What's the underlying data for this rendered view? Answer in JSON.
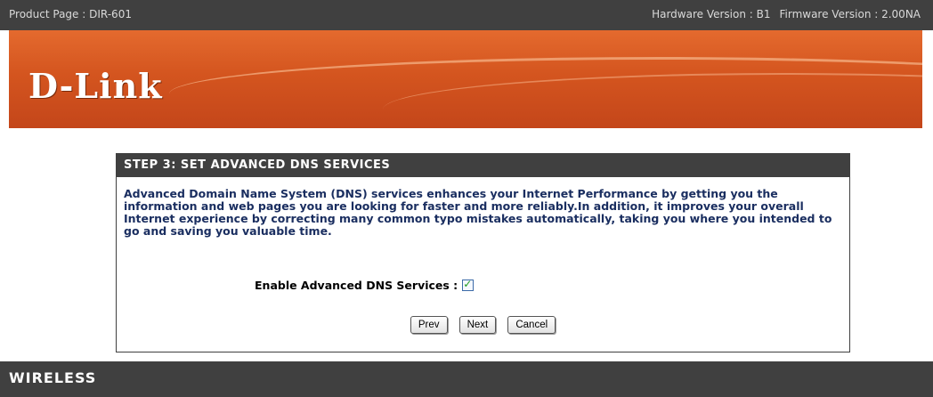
{
  "topbar": {
    "product": "Product Page : DIR-601",
    "hardware": "Hardware Version : B1",
    "firmware": "Firmware Version : 2.00NA"
  },
  "banner": {
    "logo_text": "D-Link"
  },
  "wizard": {
    "title": "STEP 3: SET ADVANCED DNS SERVICES",
    "description": "Advanced Domain Name System (DNS) services enhances your Internet Performance by getting you the information and web pages you are looking for faster and more reliably.In addition, it improves your overall Internet experience by correcting many common typo mistakes automatically, taking you where you intended to go and saving you valuable time.",
    "dns_label": "Enable Advanced DNS Services :",
    "dns_checked": true,
    "buttons": {
      "prev": "Prev",
      "next": "Next",
      "cancel": "Cancel"
    }
  },
  "footer": {
    "label": "WIRELESS"
  },
  "colors": {
    "accent": "#d4551f",
    "bar": "#404040",
    "text_blue": "#1a2e60"
  }
}
